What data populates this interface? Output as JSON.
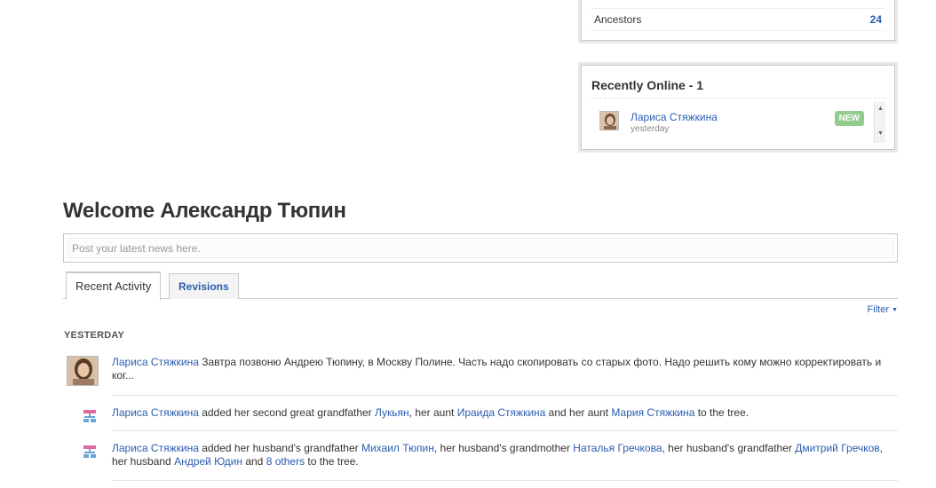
{
  "stats": {
    "label": "Ancestors",
    "count": "24"
  },
  "online": {
    "title": "Recently Online - 1",
    "user": {
      "name": "Лариса Стяжкина",
      "time": "yesterday",
      "badge": "NEW"
    }
  },
  "welcome": "Welcome Александр Тюпин",
  "news": {
    "placeholder": "Post your latest news here."
  },
  "tabs": {
    "active": "Recent Activity",
    "inactive": "Revisions"
  },
  "filter": "Filter",
  "section": "YESTERDAY",
  "activities": [
    {
      "user": "Лариса Стяжкина",
      "text": " Завтра позвоню Андрею Тюпину, в Москву Полине. Часть надо скопировать со старых фото. Надо решить кому можно корректировать и ког..."
    },
    {
      "user": "Лариса Стяжкина",
      "t1": " added her second great grandfather ",
      "l1": "Лукьян",
      "t2": ", her aunt ",
      "l2": "Ираида Стяжкина",
      "t3": " and her aunt ",
      "l3": "Мария Стяжкина",
      "t4": " to the tree."
    },
    {
      "user": "Лариса Стяжкина",
      "t1": " added her husband's grandfather ",
      "l1": "Михаил Тюпин",
      "t2": ", her husband's grandmother ",
      "l2": "Наталья Гречкова",
      "t3": ", her husband's grandfather ",
      "l3": "Дмитрий Гречков",
      "t4": ", her husband ",
      "l4": "Андрей Юдин",
      "t5": " and ",
      "l5": "8 others",
      "t6": " to the tree."
    }
  ]
}
